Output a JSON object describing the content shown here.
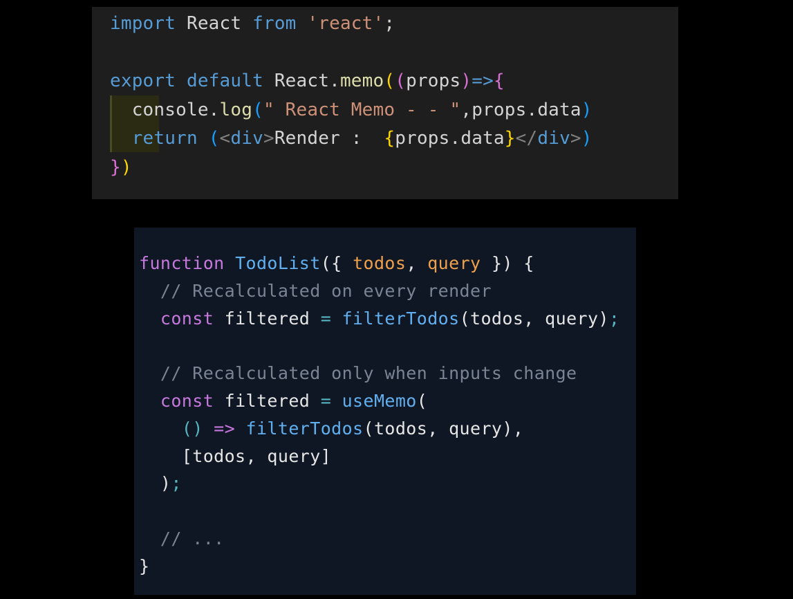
{
  "colors": {
    "background": "#000000",
    "top_panel_bg": "#1e1e1e",
    "bottom_panel_bg": "#0f1724",
    "indent_highlight": "#2b2a13"
  },
  "top_code": {
    "lines": [
      [
        {
          "t": "import",
          "c": "#569cd6"
        },
        {
          "t": " React ",
          "c": "#d4d4d4"
        },
        {
          "t": "from",
          "c": "#569cd6"
        },
        {
          "t": " ",
          "c": "#d4d4d4"
        },
        {
          "t": "'react'",
          "c": "#ce9178"
        },
        {
          "t": ";",
          "c": "#d4d4d4"
        }
      ],
      [],
      [
        {
          "t": "export",
          "c": "#569cd6"
        },
        {
          "t": " ",
          "c": "#d4d4d4"
        },
        {
          "t": "default",
          "c": "#569cd6"
        },
        {
          "t": " React.",
          "c": "#d4d4d4"
        },
        {
          "t": "memo",
          "c": "#dcdcaa"
        },
        {
          "t": "(",
          "c": "#ffd700"
        },
        {
          "t": "(",
          "c": "#da70d6"
        },
        {
          "t": "props",
          "c": "#d4d4d4"
        },
        {
          "t": ")",
          "c": "#da70d6"
        },
        {
          "t": "=>",
          "c": "#569cd6"
        },
        {
          "t": "{",
          "c": "#da70d6"
        }
      ],
      [
        {
          "t": "  console.",
          "c": "#d4d4d4"
        },
        {
          "t": "log",
          "c": "#dcdcaa"
        },
        {
          "t": "(",
          "c": "#179fff"
        },
        {
          "t": "\" React Memo - - \"",
          "c": "#ce9178"
        },
        {
          "t": ",props.data",
          "c": "#d4d4d4"
        },
        {
          "t": ")",
          "c": "#179fff"
        }
      ],
      [
        {
          "t": "  return",
          "c": "#569cd6"
        },
        {
          "t": " ",
          "c": "#d4d4d4"
        },
        {
          "t": "(",
          "c": "#179fff"
        },
        {
          "t": "<",
          "c": "#808080"
        },
        {
          "t": "div",
          "c": "#569cd6"
        },
        {
          "t": ">",
          "c": "#808080"
        },
        {
          "t": "Render :  ",
          "c": "#d4d4d4"
        },
        {
          "t": "{",
          "c": "#ffd700"
        },
        {
          "t": "props.data",
          "c": "#d4d4d4"
        },
        {
          "t": "}",
          "c": "#ffd700"
        },
        {
          "t": "</",
          "c": "#808080"
        },
        {
          "t": "div",
          "c": "#569cd6"
        },
        {
          "t": ">",
          "c": "#808080"
        },
        {
          "t": ")",
          "c": "#179fff"
        }
      ],
      [
        {
          "t": "}",
          "c": "#da70d6"
        },
        {
          "t": ")",
          "c": "#ffd700"
        }
      ]
    ]
  },
  "bottom_code": {
    "lines": [
      [
        {
          "t": "function",
          "c": "#c678dd"
        },
        {
          "t": " ",
          "c": "#e6e6e6"
        },
        {
          "t": "TodoList",
          "c": "#61afef"
        },
        {
          "t": "({ ",
          "c": "#e6e6e6"
        },
        {
          "t": "todos",
          "c": "#f0a04b"
        },
        {
          "t": ", ",
          "c": "#e6e6e6"
        },
        {
          "t": "query",
          "c": "#f0a04b"
        },
        {
          "t": " }) {",
          "c": "#e6e6e6"
        }
      ],
      [
        {
          "t": "  // Recalculated on every render",
          "c": "#7b8494"
        }
      ],
      [
        {
          "t": "  const",
          "c": "#c678dd"
        },
        {
          "t": " filtered ",
          "c": "#e6e6e6"
        },
        {
          "t": "=",
          "c": "#56b6c2"
        },
        {
          "t": " ",
          "c": "#e6e6e6"
        },
        {
          "t": "filterTodos",
          "c": "#61afef"
        },
        {
          "t": "(todos, query)",
          "c": "#e6e6e6"
        },
        {
          "t": ";",
          "c": "#56b6c2"
        }
      ],
      [],
      [
        {
          "t": "  // Recalculated only when inputs change",
          "c": "#7b8494"
        }
      ],
      [
        {
          "t": "  const",
          "c": "#c678dd"
        },
        {
          "t": " filtered ",
          "c": "#e6e6e6"
        },
        {
          "t": "=",
          "c": "#56b6c2"
        },
        {
          "t": " ",
          "c": "#e6e6e6"
        },
        {
          "t": "useMemo",
          "c": "#61afef"
        },
        {
          "t": "(",
          "c": "#e6e6e6"
        }
      ],
      [
        {
          "t": "    ",
          "c": "#e6e6e6"
        },
        {
          "t": "()",
          "c": "#56b6c2"
        },
        {
          "t": " ",
          "c": "#e6e6e6"
        },
        {
          "t": "=>",
          "c": "#c678dd"
        },
        {
          "t": " ",
          "c": "#e6e6e6"
        },
        {
          "t": "filterTodos",
          "c": "#61afef"
        },
        {
          "t": "(todos, query),",
          "c": "#e6e6e6"
        }
      ],
      [
        {
          "t": "    [todos, query]",
          "c": "#e6e6e6"
        }
      ],
      [
        {
          "t": "  )",
          "c": "#e6e6e6"
        },
        {
          "t": ";",
          "c": "#56b6c2"
        }
      ],
      [],
      [
        {
          "t": "  // ...",
          "c": "#7b8494"
        }
      ],
      [
        {
          "t": "}",
          "c": "#e6e6e6"
        }
      ]
    ]
  }
}
